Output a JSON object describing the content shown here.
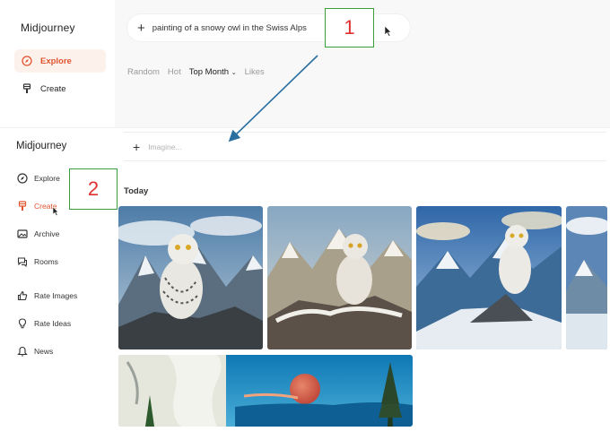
{
  "panel1": {
    "logo": "Midjourney",
    "nav": [
      {
        "label": "Explore",
        "icon": "compass-icon",
        "active": true
      },
      {
        "label": "Create",
        "icon": "brush-icon",
        "active": false
      }
    ],
    "prompt": {
      "plus": "+",
      "text": "painting of a snowy owl in the Swiss Alps"
    },
    "tabs": [
      "Random",
      "Hot",
      "Top Month",
      "Likes"
    ],
    "tab_active": "Top Month"
  },
  "panel2": {
    "logo": "Midjourney",
    "nav": [
      {
        "label": "Explore",
        "icon": "compass-icon"
      },
      {
        "label": "Create",
        "icon": "brush-icon",
        "active": true
      },
      {
        "label": "Archive",
        "icon": "image-icon"
      },
      {
        "label": "Rooms",
        "icon": "chat-icon"
      },
      {
        "label": "Rate Images",
        "icon": "thumbs-up-icon"
      },
      {
        "label": "Rate Ideas",
        "icon": "lightbulb-icon"
      },
      {
        "label": "News",
        "icon": "bell-icon"
      }
    ],
    "imagine": {
      "plus": "+",
      "placeholder": "Imagine..."
    },
    "section": "Today"
  },
  "annotations": {
    "step1": "1",
    "step2": "2"
  },
  "colors": {
    "accent": "#e0542f",
    "annotation_border": "#3a9f3a",
    "annotation_text": "#e03030",
    "arrow": "#2a6fa0"
  }
}
